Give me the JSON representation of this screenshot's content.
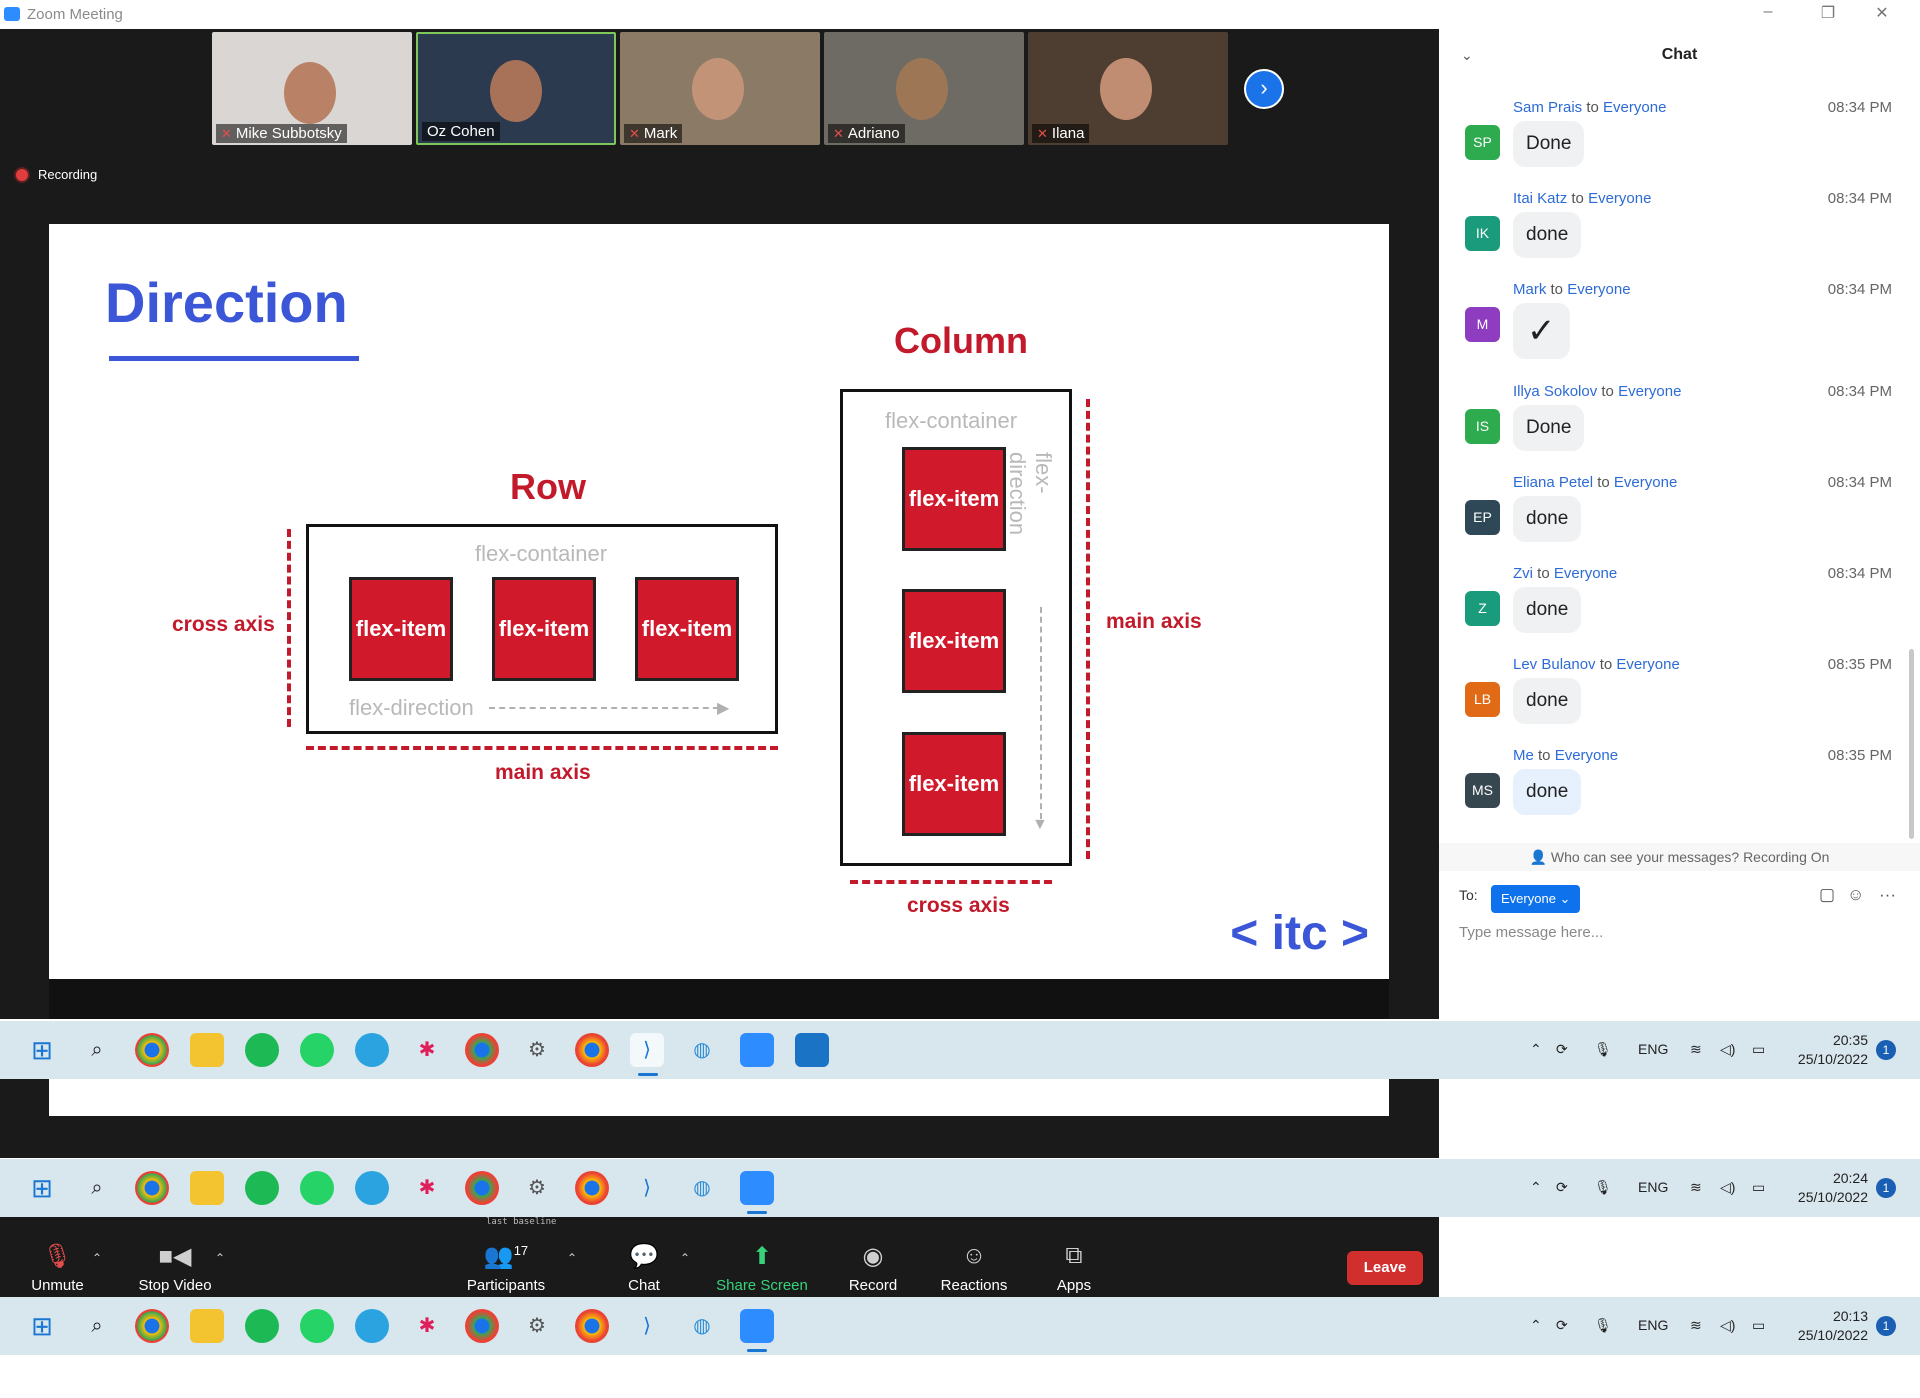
{
  "window": {
    "title": "Zoom Meeting",
    "controls": [
      "–",
      "❐",
      "✕"
    ]
  },
  "participants_strip": [
    {
      "name": "Mike Subbotsky",
      "muted": true
    },
    {
      "name": "Oz Cohen",
      "muted": false
    },
    {
      "name": "Mark",
      "muted": true
    },
    {
      "name": "Adriano",
      "muted": true
    },
    {
      "name": "Ilana",
      "muted": true
    }
  ],
  "next_icon": "chevron-right-icon",
  "recording_label": "Recording",
  "slide": {
    "title": "Direction",
    "row_label": "Row",
    "column_label": "Column",
    "container_label": "flex-container",
    "item_label": "flex-item",
    "direction_label": "flex-direction",
    "cross_axis": "cross axis",
    "main_axis": "main axis",
    "brand": "< itc >"
  },
  "chat": {
    "header": "Chat",
    "messages": [
      {
        "sender": "Sam Prais",
        "to": "to",
        "recipient": "Everyone",
        "time": "08:34 PM",
        "initials": "SP",
        "color": "#2eaa4f",
        "text": "Done"
      },
      {
        "sender": "Itai Katz",
        "to": "to",
        "recipient": "Everyone",
        "time": "08:34 PM",
        "initials": "IK",
        "color": "#1a9b7b",
        "text": "done"
      },
      {
        "sender": "Mark",
        "to": "to",
        "recipient": "Everyone",
        "time": "08:34 PM",
        "initials": "M",
        "color": "#8e3cc0",
        "text": "✓"
      },
      {
        "sender": "Illya Sokolov",
        "to": "to",
        "recipient": "Everyone",
        "time": "08:34 PM",
        "initials": "IS",
        "color": "#2eaa4f",
        "text": "Done"
      },
      {
        "sender": "Eliana Petel",
        "to": "to",
        "recipient": "Everyone",
        "time": "08:34 PM",
        "initials": "EP",
        "color": "#2f4858",
        "text": "done"
      },
      {
        "sender": "Zvi",
        "to": "to",
        "recipient": "Everyone",
        "time": "08:34 PM",
        "initials": "Z",
        "color": "#1a9b7b",
        "text": "done"
      },
      {
        "sender": "Lev Bulanov",
        "to": "to",
        "recipient": "Everyone",
        "time": "08:35 PM",
        "initials": "LB",
        "color": "#e06a16",
        "text": "done"
      },
      {
        "sender": "Me",
        "to": "to",
        "recipient": "Everyone",
        "time": "08:35 PM",
        "initials": "MS",
        "color": "#37474f",
        "text": "done"
      }
    ],
    "privacy_text": "Who can see your messages? Recording On",
    "to_label": "To:",
    "to_value": "Everyone ⌄",
    "placeholder": "Type message here..."
  },
  "taskbars": [
    {
      "time": "20:35",
      "date": "25/10/2022",
      "notifications": "1",
      "lang": "ENG"
    },
    {
      "time": "20:24",
      "date": "25/10/2022",
      "notifications": "1",
      "lang": "ENG"
    },
    {
      "time": "20:13",
      "date": "25/10/2022",
      "notifications": "1",
      "lang": "ENG"
    }
  ],
  "controls": {
    "unmute": "Unmute",
    "stop_video": "Stop Video",
    "participants": "Participants",
    "participants_count": "17",
    "chat": "Chat",
    "share_screen": "Share Screen",
    "record": "Record",
    "reactions": "Reactions",
    "apps": "Apps",
    "leave": "Leave"
  },
  "overlap_text": "last baseline"
}
